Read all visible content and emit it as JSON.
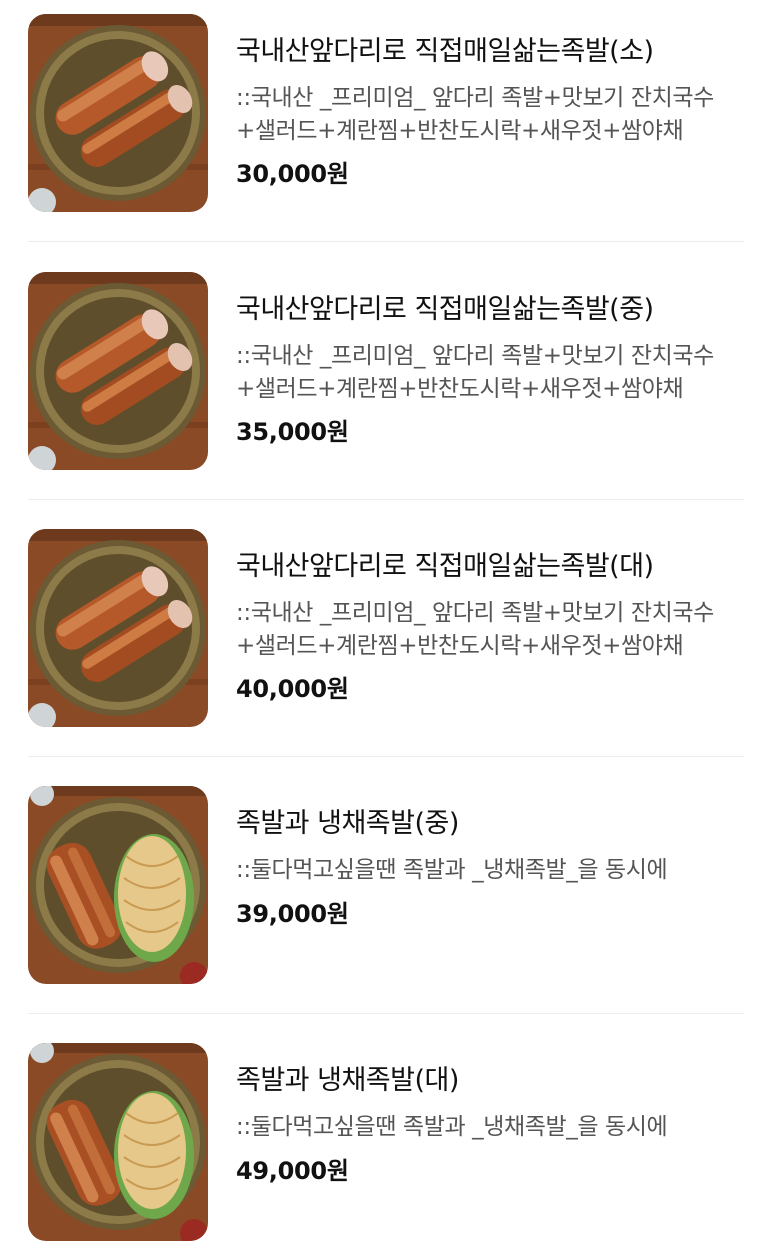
{
  "menu": {
    "items": [
      {
        "title": "국내산앞다리로 직접매일삶는족발(소)",
        "description": "::국내산 _프리미엄_ 앞다리 족발+맛보기 잔치국수+샐러드+계란찜+반찬도시락+새우젓+쌈야채",
        "price": "30,000원",
        "image_icon": "jokbal-plate-photo"
      },
      {
        "title": "국내산앞다리로 직접매일삶는족발(중)",
        "description": "::국내산 _프리미엄_ 앞다리 족발+맛보기 잔치국수+샐러드+계란찜+반찬도시락+새우젓+쌈야채",
        "price": "35,000원",
        "image_icon": "jokbal-plate-photo"
      },
      {
        "title": "국내산앞다리로 직접매일삶는족발(대)",
        "description": "::국내산 _프리미엄_ 앞다리 족발+맛보기 잔치국수+샐러드+계란찜+반찬도시락+새우젓+쌈야채",
        "price": "40,000원",
        "image_icon": "jokbal-plate-photo"
      },
      {
        "title": "족발과 냉채족발(중)",
        "description": "::둘다먹고싶을땐 족발과 _냉채족발_을 동시에",
        "price": "39,000원",
        "image_icon": "jokbal-naengchae-plate-photo"
      },
      {
        "title": "족발과 냉채족발(대)",
        "description": "::둘다먹고싶을땐 족발과 _냉채족발_을 동시에",
        "price": "49,000원",
        "image_icon": "jokbal-naengchae-plate-photo"
      }
    ]
  },
  "colors": {
    "title": "#111111",
    "description": "#555555",
    "price": "#111111",
    "divider": "#ececec",
    "wood": "#8a4a26",
    "plate_rim": "#7d6a3e",
    "jokbal": "#b5582a"
  }
}
